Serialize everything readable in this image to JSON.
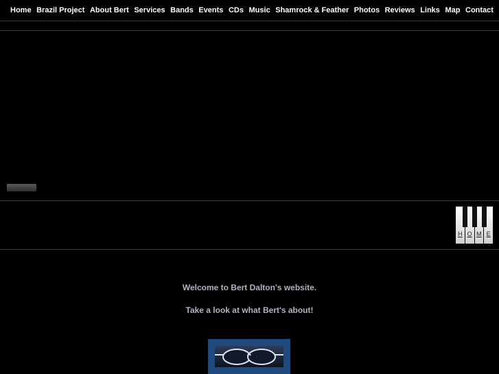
{
  "nav": {
    "items": [
      {
        "label": "Home"
      },
      {
        "label": "Brazil Project"
      },
      {
        "label": "About Bert"
      },
      {
        "label": "Services"
      },
      {
        "label": "Bands"
      },
      {
        "label": "Events"
      },
      {
        "label": "CDs"
      },
      {
        "label": "Music"
      },
      {
        "label": "Shamrock & Feather"
      },
      {
        "label": "Photos"
      },
      {
        "label": "Reviews"
      },
      {
        "label": "Links"
      },
      {
        "label": "Map"
      },
      {
        "label": "Contact"
      }
    ]
  },
  "home_keys": {
    "letters": [
      "H",
      "O",
      "M",
      "E"
    ]
  },
  "content": {
    "welcome": "Welcome to Bert Dalton's website.",
    "tagline": "Take a look at what Bert's about!"
  },
  "colors": {
    "background": "#000000",
    "text_muted": "#aeb3c0",
    "photo_frame": "#1e4a7e"
  }
}
